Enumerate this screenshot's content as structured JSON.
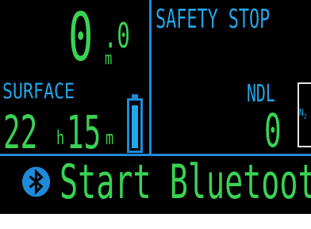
{
  "dive": {
    "depth_integer": "0",
    "depth_decimal": ".0",
    "depth_unit": "m",
    "surface_label": "SURFACE",
    "surface_time_hours": "22",
    "surface_time_hours_unit": "h",
    "surface_time_minutes": "15",
    "surface_time_minutes_unit": "m"
  },
  "battery": {
    "level_percent": 95,
    "color": "#22a7e8"
  },
  "right_panel": {
    "safety_stop_label": "SAFETY STOP",
    "ndl_label": "NDL",
    "ndl_value": "0",
    "n2_label": "N",
    "n2_subscript": "2"
  },
  "bluetooth": {
    "icon": "bluetooth-icon",
    "label": "Start Bluetooth"
  },
  "colors": {
    "background": "#000000",
    "text_green": "#39d353",
    "text_blue": "#22a7e8",
    "divider": "#1f8bd8"
  }
}
